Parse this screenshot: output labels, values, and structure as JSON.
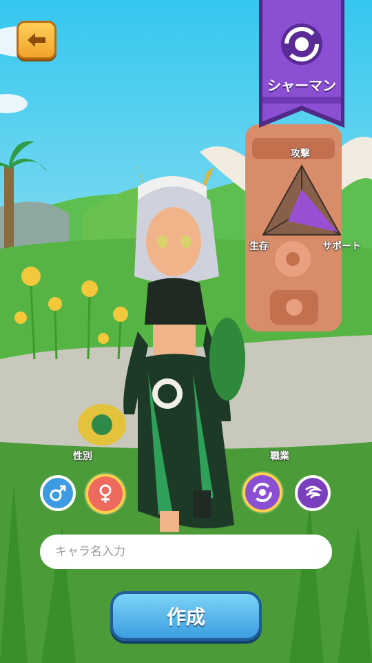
{
  "header": {
    "back_icon": "arrow-left-icon",
    "class_icon": "shaman-swirl-icon",
    "class_name": "シャーマン"
  },
  "stats": {
    "attack_label": "攻撃",
    "survival_label": "生存",
    "support_label": "サポート"
  },
  "gender": {
    "label": "性別",
    "options": [
      {
        "icon": "male-icon",
        "selected": false
      },
      {
        "icon": "female-icon",
        "selected": true
      }
    ]
  },
  "job": {
    "label": "職業",
    "options": [
      {
        "icon": "shaman-swirl-icon",
        "selected": true
      },
      {
        "icon": "wind-swirl-icon",
        "selected": false
      }
    ]
  },
  "name_input": {
    "placeholder": "キャラ名入力",
    "value": ""
  },
  "create_button": {
    "label": "作成"
  },
  "colors": {
    "banner_purple": "#8a4fd2",
    "male_blue": "#3d9be3",
    "female_red": "#ee6a5e",
    "selected_ring": "#ffd04a",
    "create_blue": "#3c9ee0"
  }
}
